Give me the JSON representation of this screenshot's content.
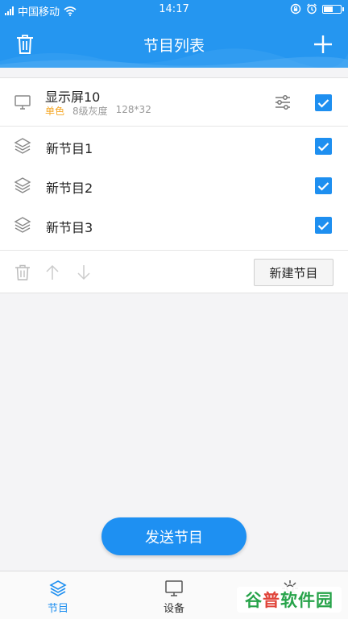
{
  "status_bar": {
    "carrier": "中国移动",
    "time": "14:17",
    "battery_level": 0.6
  },
  "header": {
    "title": "节目列表",
    "delete_icon": "trash-icon",
    "add_icon": "plus-icon"
  },
  "display": {
    "name": "显示屏10",
    "mode": "单色",
    "grayscale": "8级灰度",
    "resolution": "128*32",
    "checked": true
  },
  "programs": [
    {
      "label": "新节目1",
      "checked": true
    },
    {
      "label": "新节目2",
      "checked": true
    },
    {
      "label": "新节目3",
      "checked": true
    }
  ],
  "toolbar": {
    "new_program_label": "新建节目"
  },
  "send_button_label": "发送节目",
  "tabs": [
    {
      "label": "节目",
      "icon": "layers-icon",
      "active": true
    },
    {
      "label": "设备",
      "icon": "monitor-icon",
      "active": false
    },
    {
      "label": "",
      "icon": "gear-icon",
      "active": false
    }
  ],
  "watermark": "谷普软件园",
  "colors": {
    "primary": "#2596f0",
    "checkbox": "#1e8ff0",
    "accent": "#f5a623"
  }
}
